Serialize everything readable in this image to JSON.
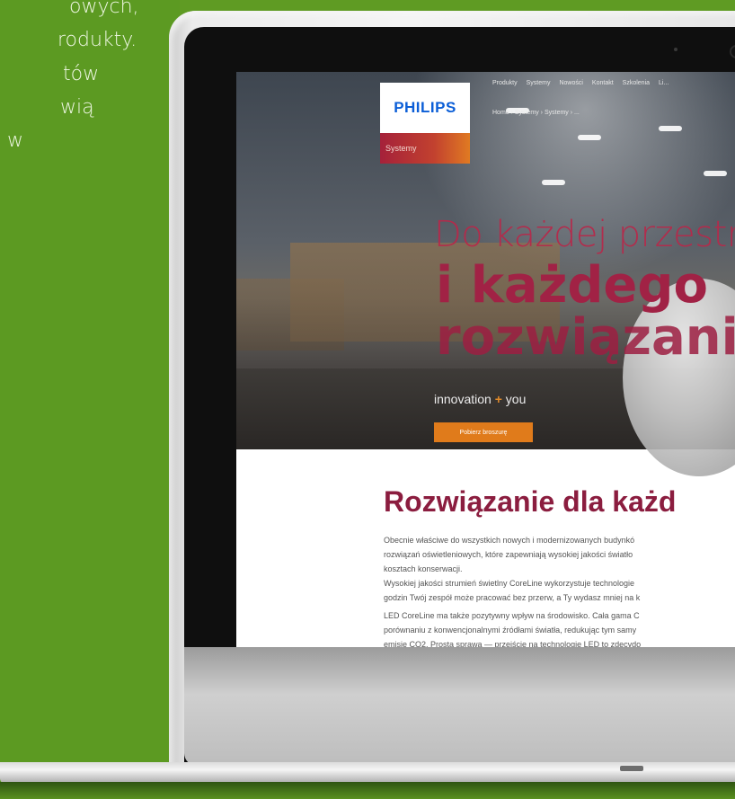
{
  "background_text": {
    "lines": [
      "owych,",
      "rodukty.",
      "tów",
      "wią",
      "w"
    ]
  },
  "site": {
    "logo": {
      "brand": "PHILIPS",
      "subtitle": "Systemy"
    },
    "nav": [
      "Produkty",
      "Systemy",
      "Nowości",
      "Kontakt",
      "Szkolenia",
      "Li..."
    ],
    "breadcrumb": "Home › Systemy › Systemy › ...",
    "hero": {
      "line1": "Do każdej przestrze",
      "line2": "i każdego",
      "line3": "rozwiązania",
      "tagline_prefix": "innovation",
      "tagline_plus": "+",
      "tagline_suffix": "you",
      "cta_label": "Pobierz broszurę"
    },
    "section": {
      "heading": "Rozwiązanie dla każd",
      "p1": [
        "Obecnie właściwe do wszystkich nowych i modernizowanych budynkó",
        "rozwiązań oświetleniowych, które zapewniają wysokiej jakości światło",
        "kosztach konserwacji."
      ],
      "p2": [
        "Wysokiej jakości strumień świetlny CoreLine wykorzystuje technologie",
        "godzin Twój zespół może pracować bez przerw, a Ty wydasz mniej na k"
      ],
      "p3": [
        "LED CoreLine ma także pozytywny wpływ na środowisko. Cała gama C",
        "porównaniu z konwencjonalnymi źródłami światła, redukując tym samy",
        "emisję CO2. Prosta sprawa — przejście na technologię LED to zdecydo"
      ]
    }
  },
  "colors": {
    "background_green": "#5f9b23",
    "brand_blue": "#0b5ed7",
    "accent_red": "#a12245",
    "cta_orange": "#e07b1b"
  }
}
